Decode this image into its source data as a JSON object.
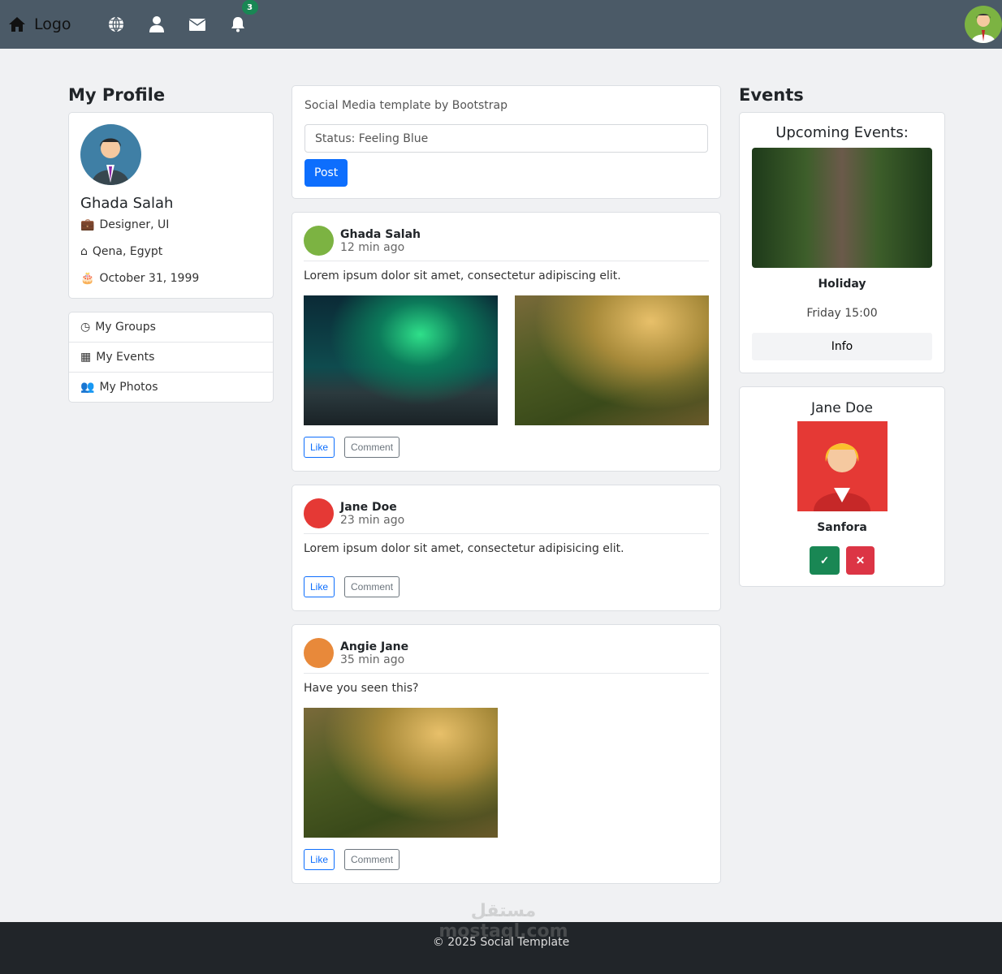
{
  "nav": {
    "logo": "Logo",
    "notification_count": "3"
  },
  "profile": {
    "heading": "My Profile",
    "name": "Ghada Salah",
    "job": "Designer, UI",
    "location": "Qena, Egypt",
    "birthday": "October 31, 1999"
  },
  "menu": [
    {
      "label": "My Groups"
    },
    {
      "label": "My Events"
    },
    {
      "label": "My Photos"
    }
  ],
  "composer": {
    "title": "Social Media template by Bootstrap",
    "value": "Status: Feeling Blue",
    "post_label": "Post"
  },
  "posts": [
    {
      "author": "Ghada Salah",
      "time": "12 min ago",
      "text": "Lorem ipsum dolor sit amet, consectetur adipiscing elit."
    },
    {
      "author": "Jane Doe",
      "time": "23 min ago",
      "text": "Lorem ipsum dolor sit amet, consectetur adipisicing elit."
    },
    {
      "author": "Angie Jane",
      "time": "35 min ago",
      "text": "Have you seen this?"
    }
  ],
  "actions": {
    "like": "Like",
    "comment": "Comment"
  },
  "events": {
    "heading": "Events",
    "upcoming": "Upcoming Events:",
    "name": "Holiday",
    "when": "Friday 15:00",
    "info": "Info"
  },
  "friend": {
    "name": "Jane Doe",
    "subtitle": "Sanfora",
    "accept": "✓",
    "decline": "✕"
  },
  "footer": {
    "text": "© 2025 Social Template"
  },
  "watermark": "مستقل mostaql.com",
  "colors": {
    "nav": "#4b5a67",
    "primary": "#0d6efd",
    "success": "#198754",
    "danger": "#dc3545",
    "footer": "#212529"
  }
}
